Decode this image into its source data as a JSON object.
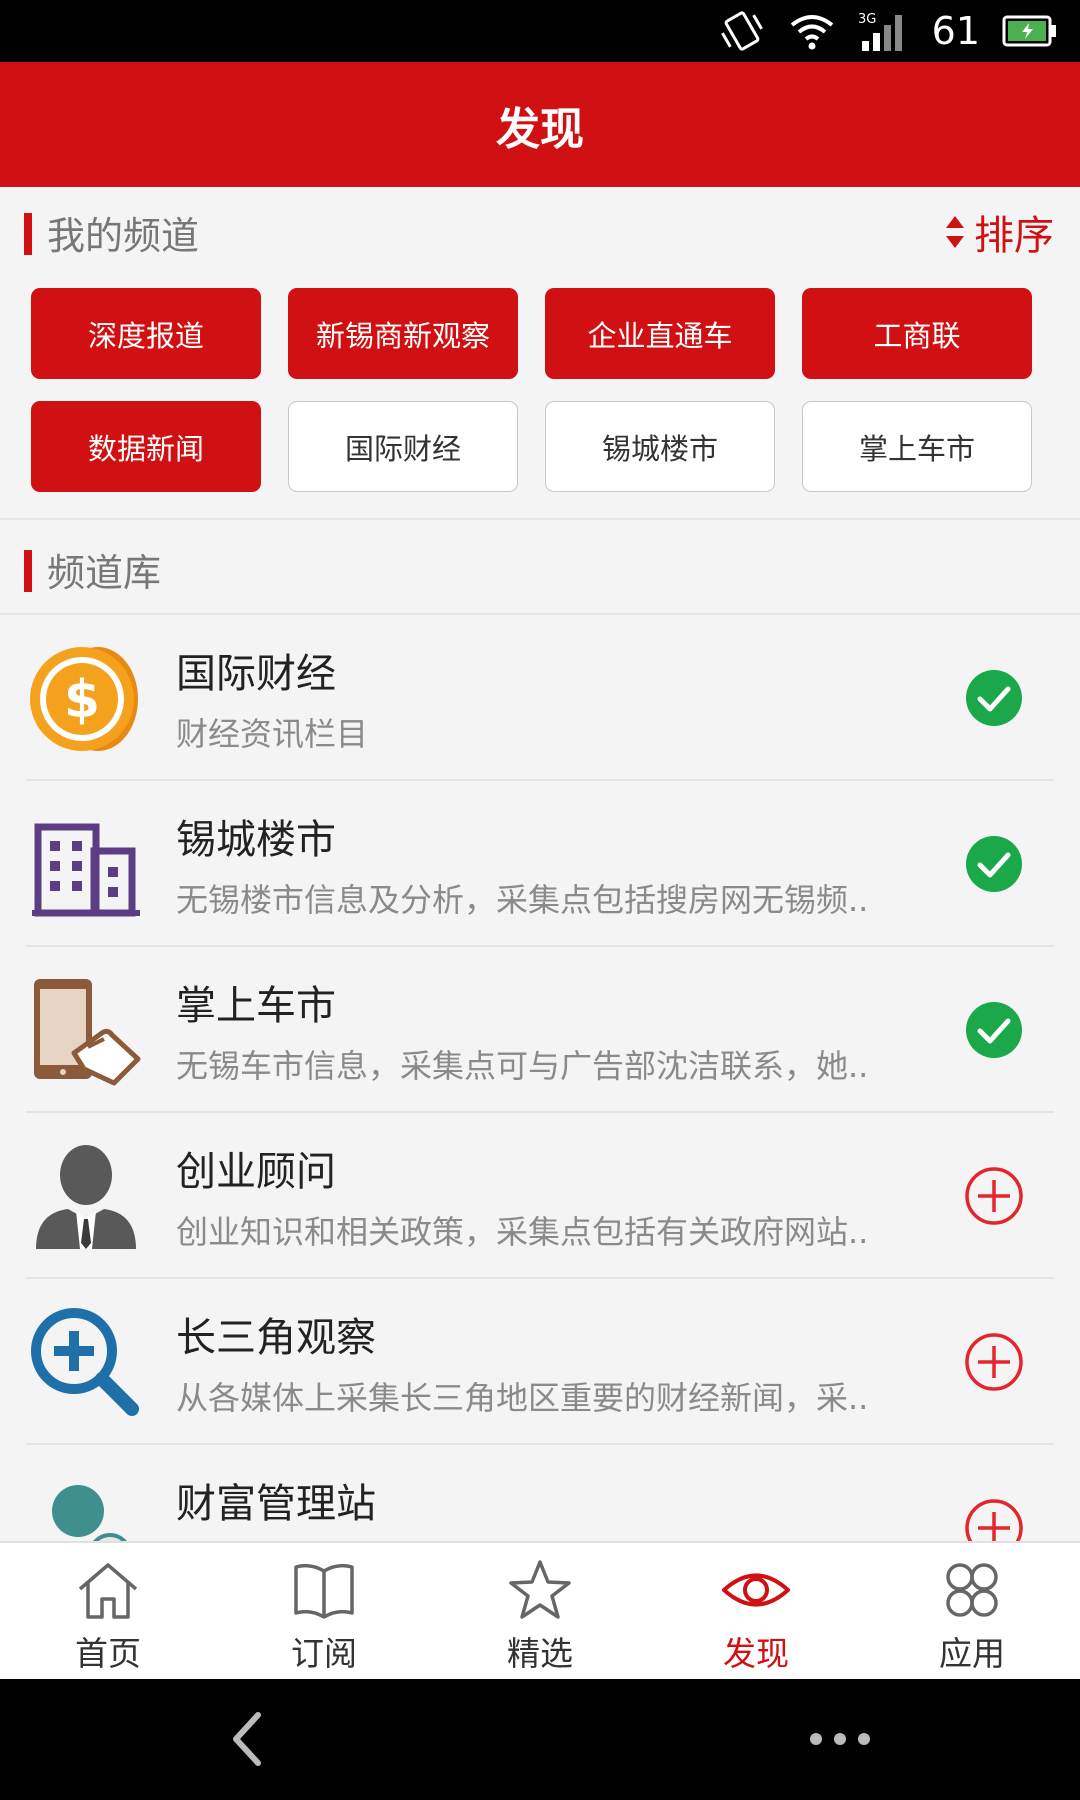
{
  "status_bar": {
    "signal": "3G",
    "battery_level": "61"
  },
  "header": {
    "title": "发现"
  },
  "my_channels": {
    "title": "我的频道",
    "sort_label": "排序",
    "chips": [
      {
        "label": "深度报道",
        "selected": true
      },
      {
        "label": "新锡商新观察",
        "selected": true
      },
      {
        "label": "企业直通车",
        "selected": true
      },
      {
        "label": "工商联",
        "selected": true
      },
      {
        "label": "数据新闻",
        "selected": true
      },
      {
        "label": "国际财经",
        "selected": false
      },
      {
        "label": "锡城楼市",
        "selected": false
      },
      {
        "label": "掌上车市",
        "selected": false
      }
    ]
  },
  "library": {
    "title": "频道库",
    "items": [
      {
        "title": "国际财经",
        "desc": "财经资讯栏目",
        "icon": "coin-icon",
        "subscribed": true
      },
      {
        "title": "锡城楼市",
        "desc": "无锡楼市信息及分析，采集点包括搜房网无锡频..",
        "icon": "building-icon",
        "subscribed": true
      },
      {
        "title": "掌上车市",
        "desc": "无锡车市信息，采集点可与广告部沈洁联系，她..",
        "icon": "phone-hand-icon",
        "subscribed": true
      },
      {
        "title": "创业顾问",
        "desc": "创业知识和相关政策，采集点包括有关政府网站..",
        "icon": "businessman-icon",
        "subscribed": false
      },
      {
        "title": "长三角观察",
        "desc": "从各媒体上采集长三角地区重要的财经新闻，采..",
        "icon": "magnifier-plus-icon",
        "subscribed": false
      },
      {
        "title": "财富管理站",
        "desc": "",
        "icon": "user-badge-icon",
        "subscribed": false
      }
    ]
  },
  "tabs": [
    {
      "label": "首页",
      "icon": "home-icon",
      "active": false
    },
    {
      "label": "订阅",
      "icon": "book-icon",
      "active": false
    },
    {
      "label": "精选",
      "icon": "star-icon",
      "active": false
    },
    {
      "label": "发现",
      "icon": "eye-icon",
      "active": true
    },
    {
      "label": "应用",
      "icon": "apps-icon",
      "active": false
    }
  ],
  "colors": {
    "accent": "#d01012",
    "check": "#1aa84a"
  }
}
